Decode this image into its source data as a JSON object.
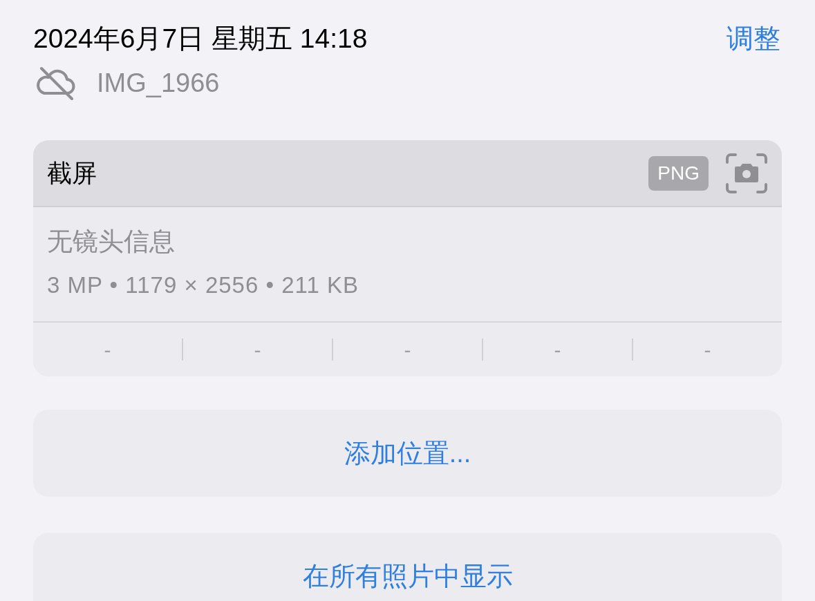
{
  "header": {
    "datetime": "2024年6月7日 星期五 14:18",
    "action": "调整"
  },
  "file": {
    "name": "IMG_1966",
    "cloud_synced": false
  },
  "info_card": {
    "title": "截屏",
    "format": "PNG",
    "no_lens": "无镜头信息",
    "details": "3 MP • 1179 × 2556 • 211 KB",
    "exposure": [
      "-",
      "-",
      "-",
      "-",
      "-"
    ]
  },
  "actions": [
    "添加位置...",
    "在所有照片中显示"
  ]
}
